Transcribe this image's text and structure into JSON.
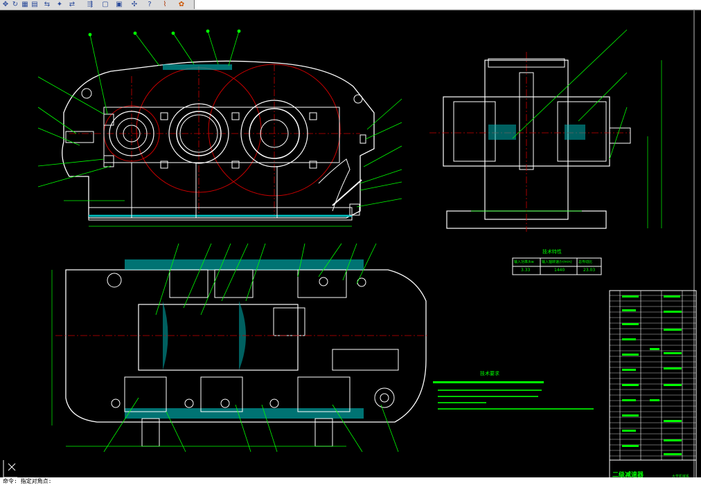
{
  "toolbar": {
    "icons": [
      "move-icon",
      "rotate-icon",
      "table-icon",
      "match-properties-icon",
      "break-icon",
      "explode-icon",
      "rectangle-icon",
      "region-icon",
      "pan-icon",
      "zoom-icon",
      "help-icon",
      "render-icon"
    ]
  },
  "colors": {
    "background": "#000000",
    "outline": "#ffffff",
    "leader": "#00ff00",
    "center": "#ff0000",
    "hatch": "#00bfbf",
    "dim": "#00ff00",
    "table": "#00ff00"
  },
  "drawing": {
    "tech_table_title": "技术特性",
    "tech_table_headers": [
      "输入功率/kw",
      "输入轴转速/(r/min)",
      "总传动比"
    ],
    "tech_table_values": [
      "3.33",
      "1440",
      "23.03"
    ],
    "tech_requirements_title": "技术要求",
    "title_block_name": "二级减速器",
    "title_block_school": "大学机械系"
  },
  "cmdline": {
    "text": "命令: 指定对角点:"
  }
}
